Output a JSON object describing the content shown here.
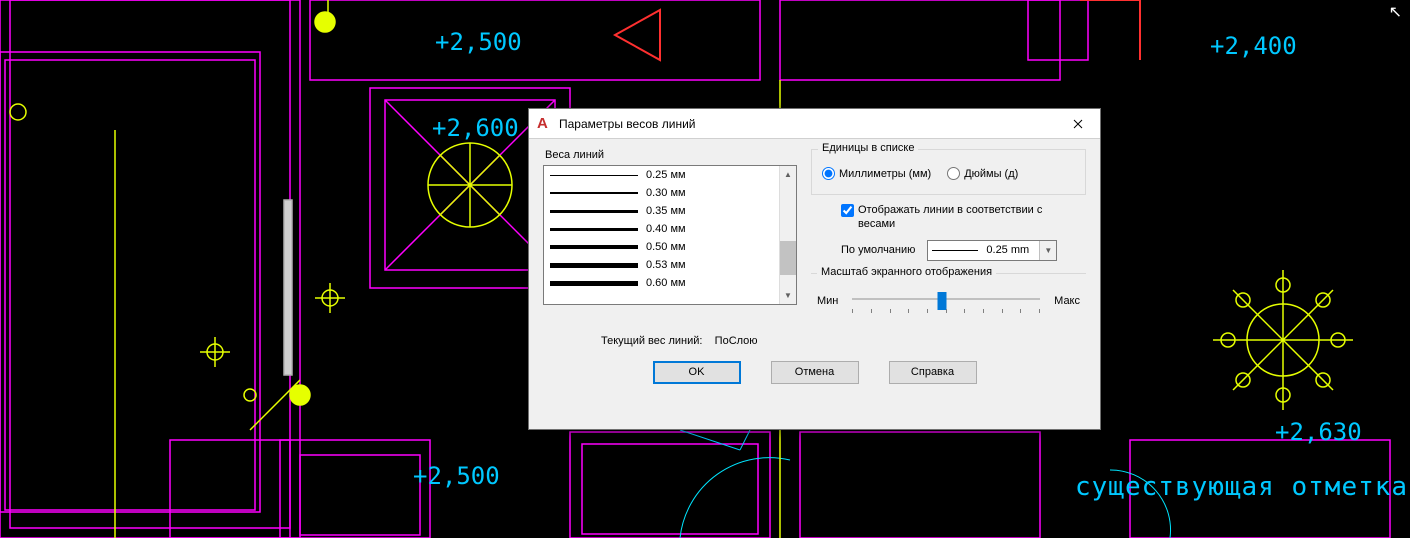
{
  "dialog": {
    "title": "Параметры весов линий",
    "lineweights_label": "Веса линий",
    "units_label": "Единицы в списке",
    "radio_mm": "Миллиметры (мм)",
    "radio_in": "Дюймы (д)",
    "display_lines_checkbox": "Отображать линии в соответствии с весами",
    "default_label": "По умолчанию",
    "default_value": "0.25 mm",
    "scale_label": "Масштаб экранного отображения",
    "min_label": "Мин",
    "max_label": "Макс",
    "current_label": "Текущий вес линий:",
    "current_value": "ПоСлою",
    "ok": "OK",
    "cancel": "Отмена",
    "help": "Справка",
    "lineweights": [
      {
        "label": "0.25 мм",
        "px": 1
      },
      {
        "label": "0.30 мм",
        "px": 2
      },
      {
        "label": "0.35 мм",
        "px": 3
      },
      {
        "label": "0.40 мм",
        "px": 3
      },
      {
        "label": "0.50 мм",
        "px": 4
      },
      {
        "label": "0.53 мм",
        "px": 5
      },
      {
        "label": "0.60 мм",
        "px": 5
      }
    ]
  },
  "cad": {
    "dim1": "+2,500",
    "dim2": "+2,600",
    "dim3": "+2,400",
    "dim4": "+2,500",
    "dim5": "+2,630",
    "note": "существующая отметка"
  }
}
